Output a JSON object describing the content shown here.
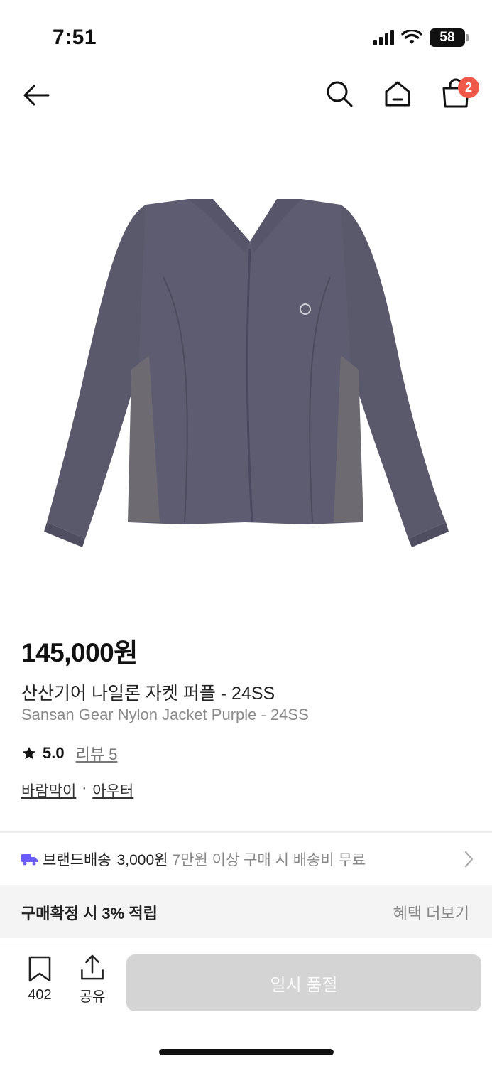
{
  "status_bar": {
    "time": "7:51",
    "battery": "58"
  },
  "nav": {
    "back_icon": "arrow-left-icon",
    "search_icon": "search-icon",
    "home_icon": "home-icon",
    "cart_icon": "shopping-bag-icon",
    "cart_count": "2"
  },
  "product": {
    "image_icon": "jacket-image",
    "jacket_color": "#5d5c70",
    "panel_color": "#6e6a72",
    "price": "145,000원",
    "name_ko": "산산기어 나일론 자켓 퍼플 - 24SS",
    "name_en": "Sansan Gear Nylon Jacket Purple - 24SS",
    "rating": "5.0",
    "review_link": "리뷰 5",
    "categories": [
      "바람막이",
      "아우터"
    ],
    "category_separator": "·"
  },
  "shipping": {
    "label": "브랜드배송",
    "fee": "3,000원",
    "condition": "7만원 이상 구매 시 배송비 무료",
    "truck_color": "#6b5cff"
  },
  "points": {
    "label": "구매확정 시 3% 적립",
    "more": "혜택 더보기"
  },
  "bottom_bar": {
    "bookmark_count": "402",
    "share_label": "공유",
    "soldout_label": "일시 품절"
  }
}
